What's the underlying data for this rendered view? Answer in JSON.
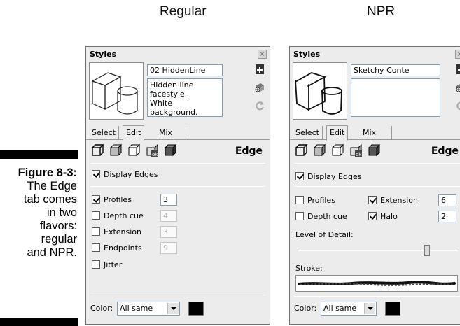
{
  "headings": {
    "regular": "Regular",
    "npr": "NPR"
  },
  "caption": {
    "figure_label": "Figure 8-3:",
    "text": "The Edge\ntab comes\nin two\nflavors:\nregular\nand NPR."
  },
  "regular_panel": {
    "title": "Styles",
    "close_glyph": "×",
    "style_name": "02 HiddenLine",
    "description": "Hidden line facestyle.\nWhite background.",
    "tabs": [
      "Select",
      "Edit",
      "Mix"
    ],
    "active_tab": "Edit",
    "section_title": "Edge",
    "display_edges": {
      "label": "Display Edges",
      "checked": true
    },
    "options": [
      {
        "label": "Profiles",
        "checked": true,
        "value": "3",
        "enabled": true
      },
      {
        "label": "Depth cue",
        "checked": false,
        "value": "4",
        "enabled": false
      },
      {
        "label": "Extension",
        "checked": false,
        "value": "3",
        "enabled": false
      },
      {
        "label": "Endpoints",
        "checked": false,
        "value": "9",
        "enabled": false
      },
      {
        "label": "Jitter",
        "checked": false
      }
    ],
    "color_label": "Color:",
    "color_value": "All same",
    "swatch_color": "#000000"
  },
  "npr_panel": {
    "title": "Styles",
    "close_glyph": "×",
    "style_name": "Sketchy Conte",
    "description": "",
    "tabs": [
      "Select",
      "Edit",
      "Mix"
    ],
    "active_tab": "Edit",
    "section_title": "Edge",
    "display_edges": {
      "label": "Display Edges",
      "checked": true
    },
    "profiles": {
      "label": "Profiles",
      "checked": false
    },
    "depth_cue": {
      "label": "Depth cue",
      "checked": false
    },
    "extension": {
      "label": "Extension",
      "checked": true,
      "value": "6"
    },
    "halo": {
      "label": "Halo",
      "checked": true,
      "value": "2"
    },
    "level_of_detail_label": "Level of Detail:",
    "level_of_detail": 0.82,
    "stroke_label": "Stroke:",
    "color_label": "Color:",
    "color_value": "All same",
    "swatch_color": "#000000"
  },
  "icons": {
    "toolbar": [
      "edge-settings-icon",
      "face-settings-icon",
      "background-settings-icon",
      "watermark-settings-icon",
      "modeling-settings-icon"
    ],
    "side": [
      "create-style-icon",
      "update-style-icon",
      "refresh-icon"
    ]
  }
}
